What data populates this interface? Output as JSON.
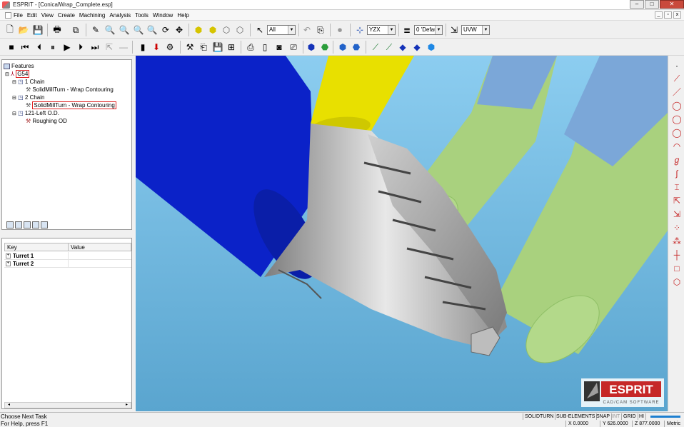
{
  "window": {
    "title": "ESPRIT - [ConicalWrap_Complete.esp]"
  },
  "menu": [
    "File",
    "Edit",
    "View",
    "Create",
    "Machining",
    "Analysis",
    "Tools",
    "Window",
    "Help"
  ],
  "toolbar": {
    "select_filter": "All",
    "plane": "YZX",
    "layer": "0 'Default'",
    "workplane": "UVW"
  },
  "features_panel": {
    "title": "Features",
    "tree": [
      {
        "label": "G54",
        "indent": 0,
        "boxed": true
      },
      {
        "label": "1 Chain",
        "indent": 1,
        "boxed": false
      },
      {
        "label": "SolidMillTurn - Wrap Contouring",
        "indent": 2,
        "boxed": false
      },
      {
        "label": "2 Chain",
        "indent": 1,
        "boxed": false
      },
      {
        "label": "SolidMillTurn - Wrap Contouring",
        "indent": 2,
        "boxed": true
      },
      {
        "label": "121-Left O.D.",
        "indent": 1,
        "boxed": false
      },
      {
        "label": "Roughing OD",
        "indent": 2,
        "boxed": false
      }
    ]
  },
  "properties_panel": {
    "columns": [
      "Key",
      "Value"
    ],
    "rows": [
      "Turret 1",
      "Turret 2"
    ]
  },
  "logo": {
    "name": "ESPRIT",
    "tagline": "CAD/CAM SOFTWARE"
  },
  "status": {
    "message": "Choose Next Task",
    "help": "For Help, press F1",
    "modes": [
      "SOLIDTURN",
      "SUB-ELEMENTS",
      "SNAP",
      "INT",
      "GRID",
      "HI"
    ],
    "x": "X 0.0000",
    "y": "Y 626.0000",
    "z": "Z 877.0000",
    "units": "Metric"
  },
  "colors": {
    "viewport_bg": "#6fb4db",
    "tool_blue": "#0b22c8",
    "tool_yellow": "#e8e000",
    "stock_green": "#a8d27f",
    "stock_blue": "#7aa6d6",
    "part_gray": "#bdbdbd",
    "logo_red": "#c62828"
  }
}
